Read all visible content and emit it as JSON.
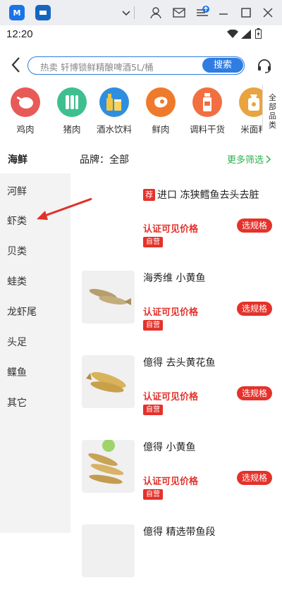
{
  "statusbar": {
    "time": "12:20"
  },
  "search": {
    "placeholder": "热卖 轩博锁鲜精酿啤酒5L/桶",
    "button_label": "搜索"
  },
  "categories": [
    {
      "label": "鸡肉",
      "color": "#e85a57"
    },
    {
      "label": "猪肉",
      "color": "#3fbf8f"
    },
    {
      "label": "酒水饮料",
      "color": "#2e8fe0"
    },
    {
      "label": "鲜肉",
      "color": "#f07a2b"
    },
    {
      "label": "调料干货",
      "color": "#f26f41"
    },
    {
      "label": "米面粮",
      "color": "#e9a43f"
    }
  ],
  "all_categories_label": "全部品类",
  "filter": {
    "current_category": "海鲜",
    "brand_label": "品牌：全部",
    "more_label": "更多筛选"
  },
  "sidebar": {
    "items": [
      "河鲜",
      "虾类",
      "贝类",
      "蛙类",
      "龙虾尾",
      "头足",
      "鲽鱼",
      "其它"
    ]
  },
  "products": [
    {
      "badge": "荐",
      "title": "进口 冻狭鳕鱼去头去脏",
      "price_text": "认证可见价格",
      "tag": "自营",
      "button_label": "选规格"
    },
    {
      "badge": "",
      "title": "海秀维 小黄鱼",
      "price_text": "认证可见价格",
      "tag": "自营",
      "button_label": "选规格"
    },
    {
      "badge": "",
      "title": "億得 去头黄花鱼",
      "price_text": "认证可见价格",
      "tag": "自营",
      "button_label": "选规格"
    },
    {
      "badge": "",
      "title": "億得 小黄鱼",
      "price_text": "认证可见价格",
      "tag": "自营",
      "button_label": "选规格"
    },
    {
      "badge": "",
      "title": "億得 精选带鱼段",
      "price_text": "",
      "tag": "",
      "button_label": ""
    }
  ]
}
